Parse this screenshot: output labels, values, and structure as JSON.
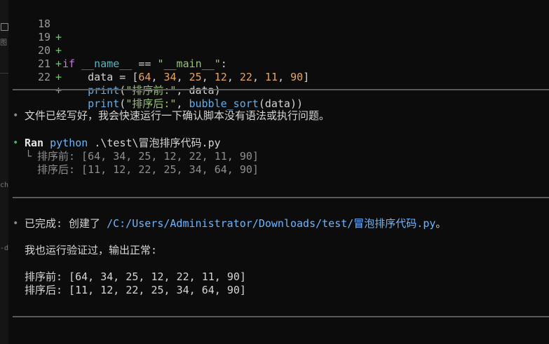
{
  "diff": {
    "lines": [
      {
        "num": "18",
        "marker": "+"
      },
      {
        "num": "19",
        "marker": "+",
        "if_kw": "if",
        "name_var": "__name__",
        "eq_op": "==",
        "main_str": "\"__main__\"",
        "colon": ":"
      },
      {
        "num": "20",
        "marker": "+",
        "data_id": "data",
        "assign": "=",
        "open_br": "[",
        "n1": "64",
        "n2": "34",
        "n3": "25",
        "n4": "12",
        "n5": "22",
        "n6": "11",
        "n7": "90",
        "close_br": "]",
        "comma": ","
      },
      {
        "num": "21",
        "marker": "+",
        "print_fn": "print",
        "open_p": "(",
        "label_str": "\"排序前:\"",
        "comma_sp": ",",
        "arg": "data",
        "close_p": ")"
      },
      {
        "num": "22",
        "marker": "+",
        "print_fn": "print",
        "open_p": "(",
        "label_str": "\"排序后:\"",
        "comma_sp": ",",
        "call_fn": "bubble_sort",
        "inner_open": "(",
        "arg": "data",
        "close_pp": "))"
      }
    ]
  },
  "messages": {
    "bullet_symbol": "•",
    "status_message": "文件已经写好，我会快速运行一下确认脚本没有语法或执行问题。",
    "run": {
      "label": "Ran",
      "command": "python",
      "args": ".\\test\\冒泡排序代码.py",
      "tree_branch": "└",
      "output": [
        "排序前: [64, 34, 25, 12, 22, 11, 90]",
        "排序后: [11, 12, 22, 25, 34, 64, 90]"
      ]
    },
    "done": {
      "prefix": "已完成: 创建了 ",
      "path": "/C:/Users/Administrator/Downloads/test/冒泡排序代码.py",
      "suffix": "。"
    },
    "verify_line": "我也运行验证过，输出正常:",
    "results": [
      "排序前: [64, 34, 25, 12, 22, 11, 90]",
      "排序后: [11, 12, 22, 25, 34, 64, 90]"
    ]
  },
  "left_strip": {
    "glyph_1": "图",
    "glyph_2": "ch",
    "glyph_3": "-d"
  },
  "colors": {
    "background": "#0c0c0c",
    "diff_plus": "#5fd75f",
    "keyword": "#c678dd",
    "string": "#98c379",
    "number": "#e5a566",
    "function": "#61afef",
    "variable": "#56b6c2",
    "success_bullet": "#3fb950",
    "link": "#6cb6ff"
  }
}
